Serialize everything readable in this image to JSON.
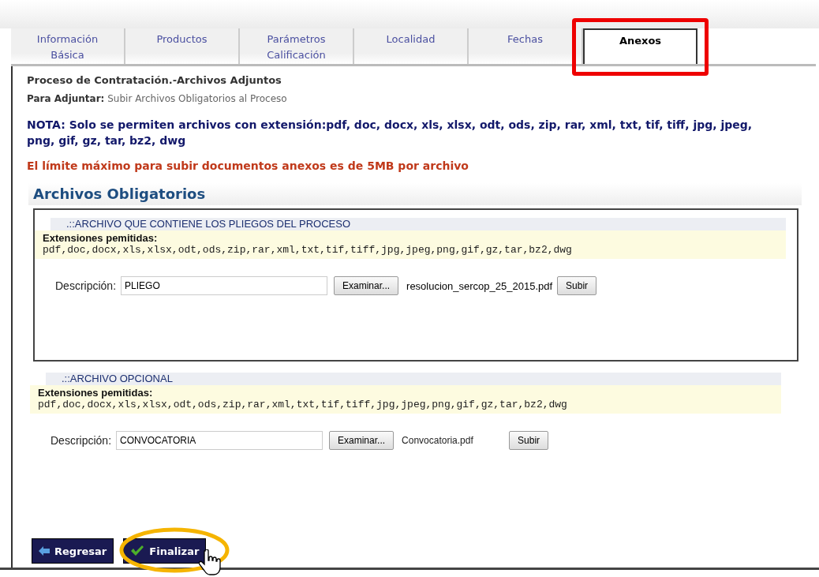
{
  "tabs": [
    {
      "label": "Información\nBásica",
      "selected": false
    },
    {
      "label": "Productos",
      "selected": false
    },
    {
      "label": "Parámetros\nCalificación",
      "selected": false
    },
    {
      "label": "Localidad",
      "selected": false
    },
    {
      "label": "Fechas",
      "selected": false
    },
    {
      "label": "Anexos",
      "selected": true
    }
  ],
  "heading": "Proceso de Contratación.-Archivos Adjuntos",
  "subheading": {
    "label": "Para Adjuntar:",
    "text": "Subir Archivos Obligatorios al Proceso"
  },
  "note": "NOTA: Solo se permiten archivos con extensión:pdf, doc, docx, xls, xlsx, odt, ods, zip, rar, xml, txt, tif, tiff, jpg, jpeg, png, gif, gz, tar, bz2, dwg",
  "limit": "El límite máximo para subir documentos anexos es de 5MB por archivo",
  "section_title": "Archivos Obligatorios",
  "uploads": [
    {
      "kind": "required",
      "title": ".::ARCHIVO QUE CONTIENE LOS PLIEGOS DEL PROCESO",
      "extensions_label": "Extensiones pemitidas:",
      "extensions": "pdf,doc,docx,xls,xlsx,odt,ods,zip,rar,xml,txt,tif,tiff,jpg,jpeg,png,gif,gz,tar,bz2,dwg",
      "description_label": "Descripción:",
      "description": "PLIEGO",
      "browse": "Examinar...",
      "file_name": "resolucion_sercop_25_2015.pdf",
      "upload": "Subir"
    },
    {
      "kind": "optional",
      "title": ".::ARCHIVO OPCIONAL",
      "extensions_label": "Extensiones pemitidas:",
      "extensions": "pdf,doc,docx,xls,xlsx,odt,ods,zip,rar,xml,txt,tif,tiff,jpg,jpeg,png,gif,gz,tar,bz2,dwg",
      "description_label": "Descripción:",
      "description": "CONVOCATORIA",
      "browse": "Examinar...",
      "file_name": "Convocatoria.pdf",
      "upload": "Subir"
    }
  ],
  "buttons": [
    {
      "kind": "back",
      "label": "Regresar"
    },
    {
      "kind": "finish",
      "label": "Finalizar"
    }
  ]
}
